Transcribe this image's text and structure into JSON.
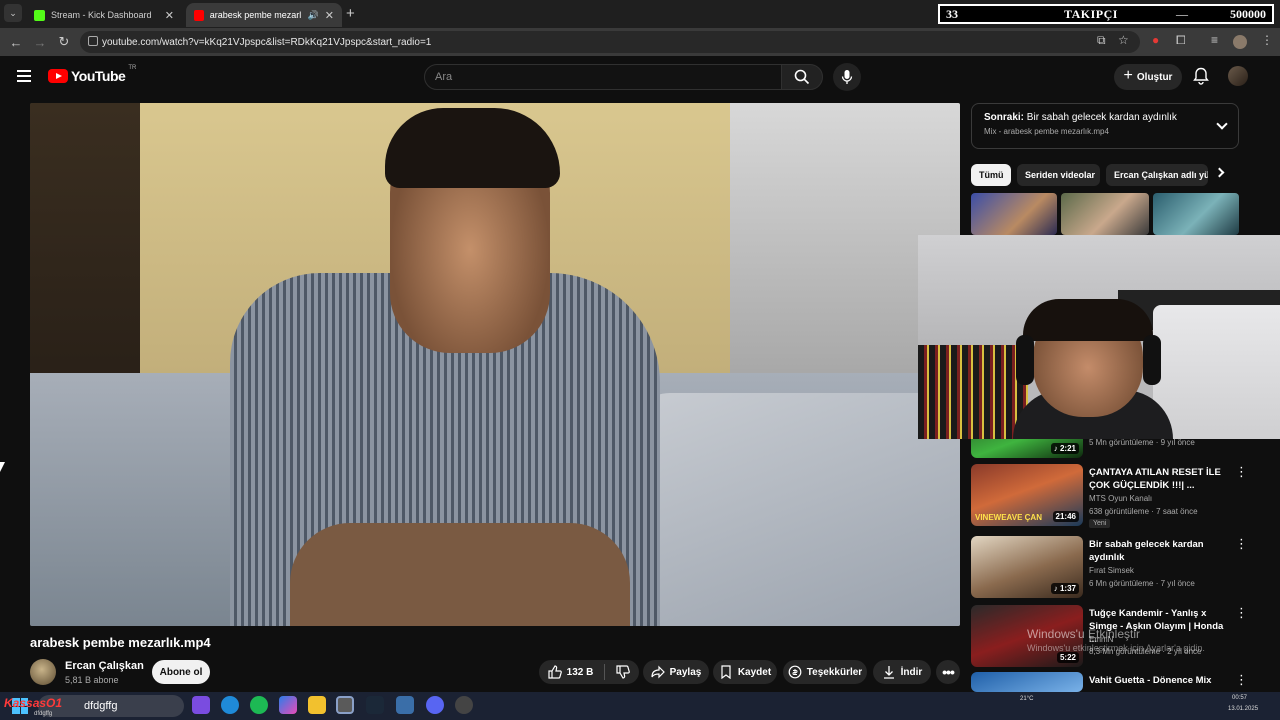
{
  "browser": {
    "tabs": [
      {
        "label": "Stream - Kick Dashboard",
        "icon": "kick-icon",
        "color": "#53fc18"
      },
      {
        "label": "arabesk pembe mezarlık.mp",
        "icon": "youtube-icon",
        "color": "#ff0000"
      }
    ],
    "url": "youtube.com/watch?v=kKq21VJpspc&list=RDkKq21VJpspc&start_radio=1"
  },
  "follower_overlay": {
    "count": "33",
    "label": "TAKIPÇI",
    "goal": "500000"
  },
  "youtube": {
    "logo": "YouTube",
    "country": "TR",
    "search_placeholder": "Ara",
    "create_label": "Oluştur"
  },
  "video": {
    "title": "arabesk pembe mezarlık.mp4",
    "channel": "Ercan Çalışkan",
    "subscribers": "5,81 B abone",
    "subscribe_label": "Abone ol",
    "likes": "132 B",
    "share_label": "Paylaş",
    "save_label": "Kaydet",
    "thanks_label": "Teşekkürler",
    "download_label": "İndir"
  },
  "up_next": {
    "prefix": "Sonraki:",
    "title": "Bir sabah gelecek kardan aydınlık",
    "subtitle": "Mix - arabesk pembe mezarlık.mp4"
  },
  "chips": [
    "Tümü",
    "Seriden videolar",
    "Ercan Çalışkan adlı yü"
  ],
  "recommendations": [
    {
      "title": "",
      "channel": "",
      "meta": "5 Mn görüntüleme · 9 yıl önce",
      "duration": "2:21"
    },
    {
      "title": "ÇANTAYA ATILAN RESET İLE ÇOK GÜÇLENDİK !!!| ...",
      "channel": "MTS Oyun Kanalı",
      "meta": "638 görüntüleme · 7 saat önce",
      "badge": "Yeni",
      "duration": "21:46",
      "thumb_text": "VINEWEAVE ÇAN"
    },
    {
      "title": "Bir sabah gelecek kardan aydınlık",
      "channel": "Fırat Simsek",
      "meta": "6 Mn görüntüleme · 7 yıl önce",
      "duration": "1:37"
    },
    {
      "title": "Tuğçe Kandemir - Yanlış x Simge - Aşkın Olayım | Honda ...",
      "channel": "EmmN",
      "meta": "8,3 Mn görüntüleme · 2 yıl önce",
      "duration": "5:22"
    },
    {
      "title": "Vahit Guetta - Dönence Mix",
      "channel": "",
      "meta": "",
      "duration": ""
    }
  ],
  "watermark": {
    "line1": "Windows'u Etkinleştir",
    "line2": "Windows'u etkinleştirmek için Ayarlar'a gidin."
  },
  "taskbar": {
    "kick_label": "KassasO1",
    "kick_sub": "dfdgffg",
    "search_text": "dfdgffg",
    "weather": "21°C",
    "time": "00:57",
    "date": "13.01.2025"
  }
}
